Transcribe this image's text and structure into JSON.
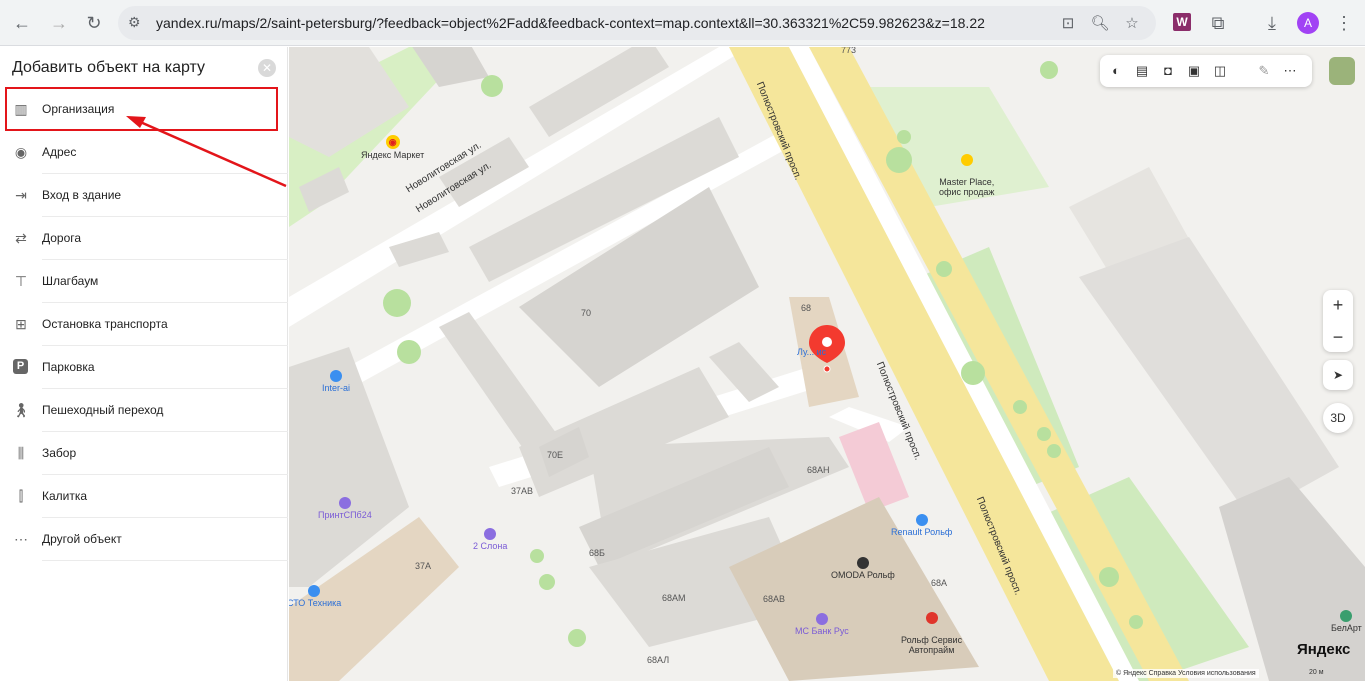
{
  "browser": {
    "url": "yandex.ru/maps/2/saint-petersburg/?feedback=object%2Fadd&feedback-context=map.context&ll=30.363321%2C59.982623&z=18.22",
    "extension_letter": "W",
    "profile_letter": "A"
  },
  "sidebar": {
    "title": "Добавить объект на карту",
    "items": [
      {
        "label": "Организация",
        "icon": "building-icon"
      },
      {
        "label": "Адрес",
        "icon": "location-pin-plus-icon"
      },
      {
        "label": "Вход в здание",
        "icon": "entrance-icon"
      },
      {
        "label": "Дорога",
        "icon": "road-sign-icon"
      },
      {
        "label": "Шлагбаум",
        "icon": "barrier-icon"
      },
      {
        "label": "Остановка транспорта",
        "icon": "bus-stop-icon"
      },
      {
        "label": "Парковка",
        "icon": "parking-icon"
      },
      {
        "label": "Пешеходный переход",
        "icon": "pedestrian-icon"
      },
      {
        "label": "Забор",
        "icon": "fence-icon"
      },
      {
        "label": "Калитка",
        "icon": "gate-icon"
      },
      {
        "label": "Другой объект",
        "icon": "more-dots-icon"
      }
    ]
  },
  "map": {
    "streets": [
      {
        "name": "Новолитовская ул.",
        "id": "a"
      },
      {
        "name": "Новолитовская ул.",
        "id": "b"
      },
      {
        "name": "Полюстровский просп.",
        "id": "c"
      },
      {
        "name": "Полюстровский просп.",
        "id": "d"
      },
      {
        "name": "Полюстровский просп.",
        "id": "e"
      }
    ],
    "house_numbers": [
      "773",
      "70",
      "68",
      "70Е",
      "37АВ",
      "37А",
      "68АН",
      "68Б",
      "68АМ",
      "68АВ",
      "68А",
      "68АЛ"
    ],
    "pois": [
      {
        "name": "Яндекс Маркет",
        "color": "#e02020"
      },
      {
        "name": "Master Place,\nофис продаж",
        "color": "#333333"
      },
      {
        "name": "Inter-ai",
        "color": "#2b6fd6"
      },
      {
        "name": "ПринтСПб24",
        "color": "#7a5bd6"
      },
      {
        "name": "2 Слона",
        "color": "#7a5bd6"
      },
      {
        "name": "СТО Техника",
        "color": "#2b6fd6"
      },
      {
        "name": "Renault Рольф",
        "color": "#2b6fd6"
      },
      {
        "name": "OMODA Рольф",
        "color": "#333333"
      },
      {
        "name": "МС Банк Рус",
        "color": "#7a5bd6"
      },
      {
        "name": "Рольф Сервис\nАвтопрайм",
        "color": "#333333"
      },
      {
        "name": "БелАрт",
        "color": "#333333"
      },
      {
        "name": "Лу... ис",
        "color": "#2b6fd6"
      }
    ],
    "controls": {
      "zoom_in": "+",
      "zoom_out": "−",
      "three_d": "3D"
    },
    "logo": "Яндекс",
    "footer": "© Яндекс   Справка   Условия использования",
    "scale": "20 м",
    "marker_color": "#f33a2f"
  }
}
